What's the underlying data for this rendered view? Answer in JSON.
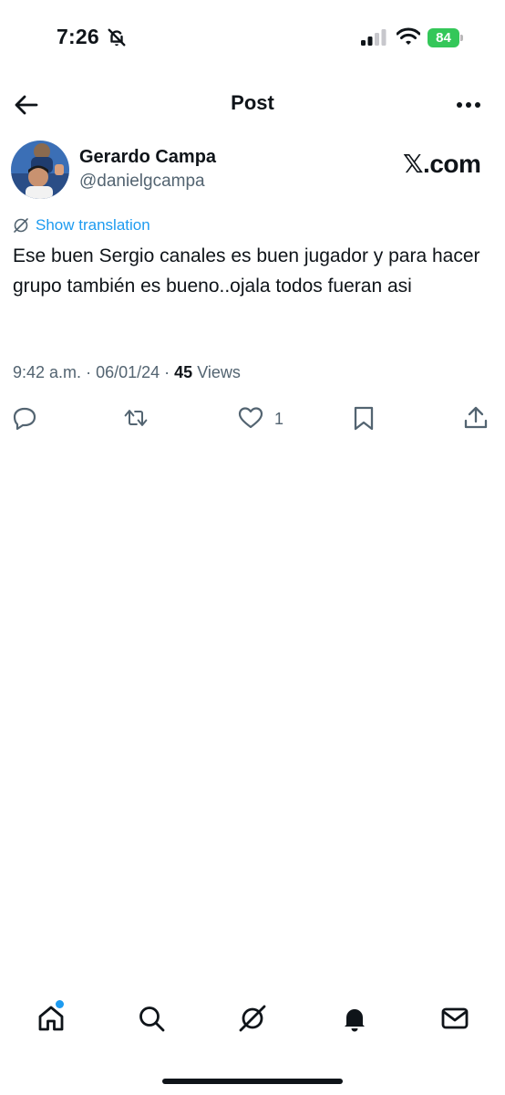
{
  "status_bar": {
    "time": "7:26",
    "battery_level": "84",
    "battery_color": "#34c759"
  },
  "header": {
    "title": "Post"
  },
  "author": {
    "name": "Gerardo Campa",
    "handle": "@danielgcampa"
  },
  "source_watermark": "𝕏.com",
  "translation": {
    "label": "Show translation"
  },
  "post": {
    "text": "Ese buen Sergio canales es buen jugador y para hacer grupo también es bueno..ojala todos fueran asi",
    "time": "9:42 a.m.",
    "date": "06/01/24",
    "views_count": "45",
    "views_label": "Views",
    "like_count": "1"
  },
  "actions": [
    "reply-icon",
    "repost-icon",
    "like-icon",
    "bookmark-icon",
    "share-icon"
  ],
  "bottom_nav": {
    "items": [
      "home-icon",
      "search-icon",
      "grok-icon",
      "notifications-icon",
      "messages-icon"
    ],
    "home_has_notification_dot": true,
    "accent_color": "#1d9bf0"
  }
}
